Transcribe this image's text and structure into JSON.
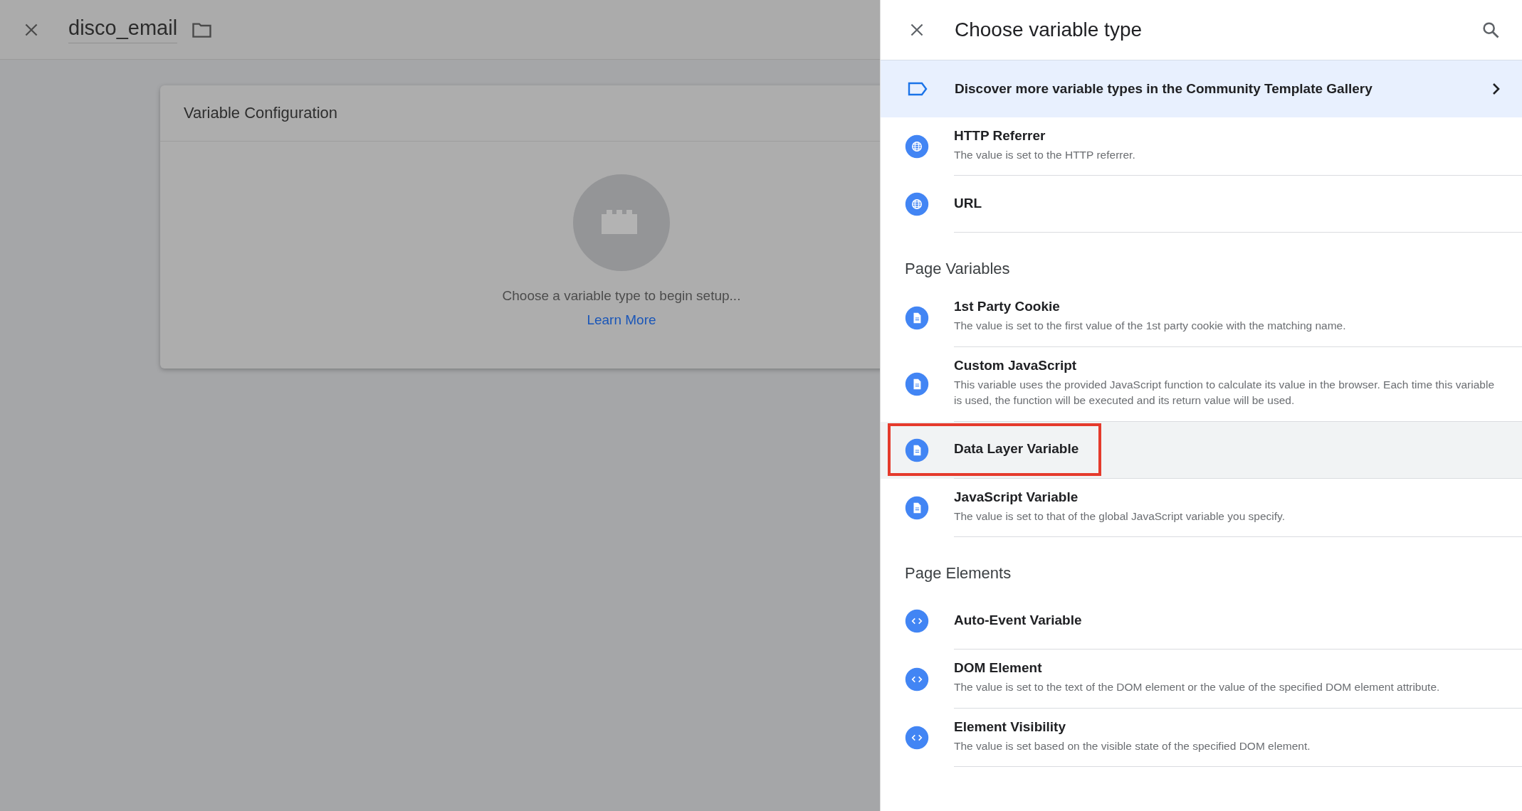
{
  "editor": {
    "title": "disco_email",
    "card": {
      "title": "Variable Configuration",
      "prompt": "Choose a variable type to begin setup...",
      "link": "Learn More"
    }
  },
  "panel": {
    "title": "Choose variable type",
    "banner": "Discover more variable types in the Community Template Gallery",
    "sections": [
      {
        "items": [
          {
            "kind": "globe",
            "name": "HTTP Referrer",
            "description": "The value is set to the HTTP referrer.",
            "selected": false,
            "highlighted": false
          },
          {
            "kind": "globe",
            "name": "URL",
            "selected": false,
            "highlighted": false
          }
        ]
      },
      {
        "title": "Page Variables",
        "items": [
          {
            "kind": "doc",
            "name": "1st Party Cookie",
            "description": "The value is set to the first value of the 1st party cookie with the matching name.",
            "selected": false,
            "highlighted": false
          },
          {
            "kind": "doc",
            "name": "Custom JavaScript",
            "description": "This variable uses the provided JavaScript function to calculate its value in the browser. Each time this variable is used, the function will be executed and its return value will be used.",
            "selected": false,
            "highlighted": false
          },
          {
            "kind": "doc",
            "name": "Data Layer Variable",
            "selected": true,
            "highlighted": true
          },
          {
            "kind": "doc",
            "name": "JavaScript Variable",
            "description": "The value is set to that of the global JavaScript variable you specify.",
            "selected": false,
            "highlighted": false
          }
        ]
      },
      {
        "title": "Page Elements",
        "items": [
          {
            "kind": "code",
            "name": "Auto-Event Variable",
            "selected": false,
            "highlighted": false
          },
          {
            "kind": "code",
            "name": "DOM Element",
            "description": "The value is set to the text of the DOM element or the value of the specified DOM element attribute.",
            "selected": false,
            "highlighted": false
          },
          {
            "kind": "code",
            "name": "Element Visibility",
            "description": "The value is set based on the visible state of the specified DOM element.",
            "selected": false,
            "highlighted": false
          }
        ]
      }
    ]
  }
}
